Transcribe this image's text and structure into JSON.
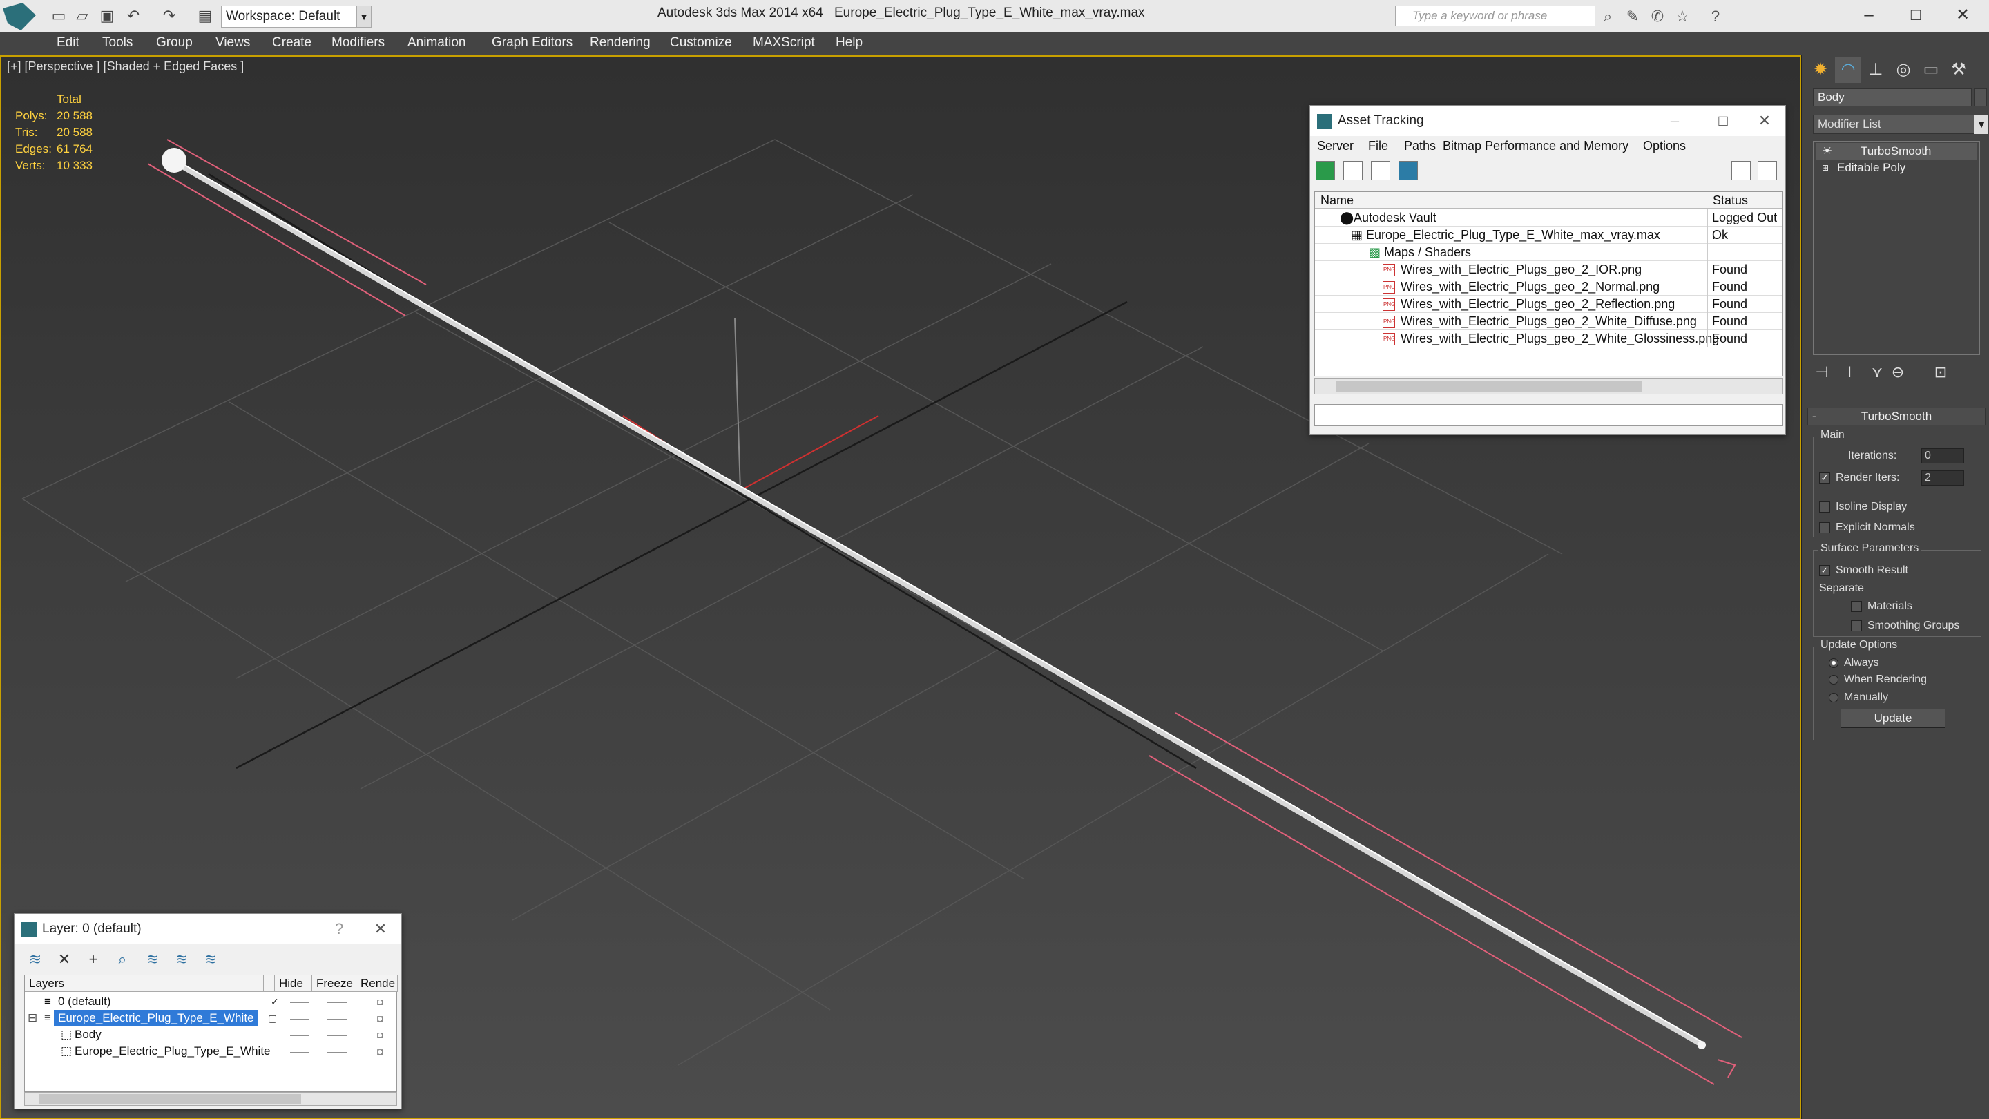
{
  "titlebar": {
    "workspace": "Workspace: Default",
    "app_title": "Autodesk 3ds Max  2014 x64",
    "file_title": "Europe_Electric_Plug_Type_E_White_max_vray.max",
    "search_placeholder": "Type a keyword or phrase"
  },
  "menu": [
    "Edit",
    "Tools",
    "Group",
    "Views",
    "Create",
    "Modifiers",
    "Animation",
    "Graph Editors",
    "Rendering",
    "Customize",
    "MAXScript",
    "Help"
  ],
  "viewport": {
    "label": "[+] [Perspective ] [Shaded + Edged Faces ]",
    "stats_header": "Total",
    "stats": [
      {
        "label": "Polys:",
        "value": "20 588"
      },
      {
        "label": "Tris:",
        "value": "20 588"
      },
      {
        "label": "Edges:",
        "value": "61 764"
      },
      {
        "label": "Verts:",
        "value": "10 333"
      }
    ],
    "colors": {
      "grid": "#5a5a5a",
      "wire": "#e8e8e8",
      "selection": "#e0607a",
      "axis_x": "#d03030"
    }
  },
  "asset_tracking": {
    "title": "Asset Tracking",
    "menu": [
      "Server",
      "File",
      "Paths",
      "Bitmap Performance and Memory",
      "Options"
    ],
    "col_name": "Name",
    "col_status": "Status",
    "rows": [
      {
        "name": "Autodesk Vault",
        "status": "Logged Out ."
      },
      {
        "name": "Europe_Electric_Plug_Type_E_White_max_vray.max",
        "status": "Ok"
      },
      {
        "name": "Maps / Shaders",
        "status": ""
      },
      {
        "name": "Wires_with_Electric_Plugs_geo_2_IOR.png",
        "status": "Found"
      },
      {
        "name": "Wires_with_Electric_Plugs_geo_2_Normal.png",
        "status": "Found"
      },
      {
        "name": "Wires_with_Electric_Plugs_geo_2_Reflection.png",
        "status": "Found"
      },
      {
        "name": "Wires_with_Electric_Plugs_geo_2_White_Diffuse.png",
        "status": "Found"
      },
      {
        "name": "Wires_with_Electric_Plugs_geo_2_White_Glossiness.png",
        "status": "Found"
      }
    ]
  },
  "layer_window": {
    "title": "Layer: 0 (default)",
    "help": "?",
    "col_layers": "Layers",
    "col_hide": "Hide",
    "col_freeze": "Freeze",
    "col_render": "Rende",
    "rows": [
      {
        "name": "0 (default)"
      },
      {
        "name": "Europe_Electric_Plug_Type_E_White"
      },
      {
        "name": "Body"
      },
      {
        "name": "Europe_Electric_Plug_Type_E_White"
      }
    ]
  },
  "command_panel": {
    "object_name": "Body",
    "modifier_list": "Modifier List",
    "stack": [
      "TurboSmooth",
      "Editable Poly"
    ],
    "rollout_title": "TurboSmooth",
    "main_group": "Main",
    "iterations_label": "Iterations:",
    "iterations_value": "0",
    "render_iters_label": "Render Iters:",
    "render_iters_value": "2",
    "isoline_label": "Isoline Display",
    "explicit_normals_label": "Explicit Normals",
    "surface_group": "Surface Parameters",
    "smooth_result_label": "Smooth Result",
    "separate_label": "Separate",
    "materials_label": "Materials",
    "smoothing_groups_label": "Smoothing Groups",
    "update_group": "Update Options",
    "always_label": "Always",
    "when_rendering_label": "When Rendering",
    "manually_label": "Manually",
    "update_button": "Update",
    "render_iters_checked": true,
    "smooth_result_checked": true,
    "update_option_selected": "Always"
  }
}
